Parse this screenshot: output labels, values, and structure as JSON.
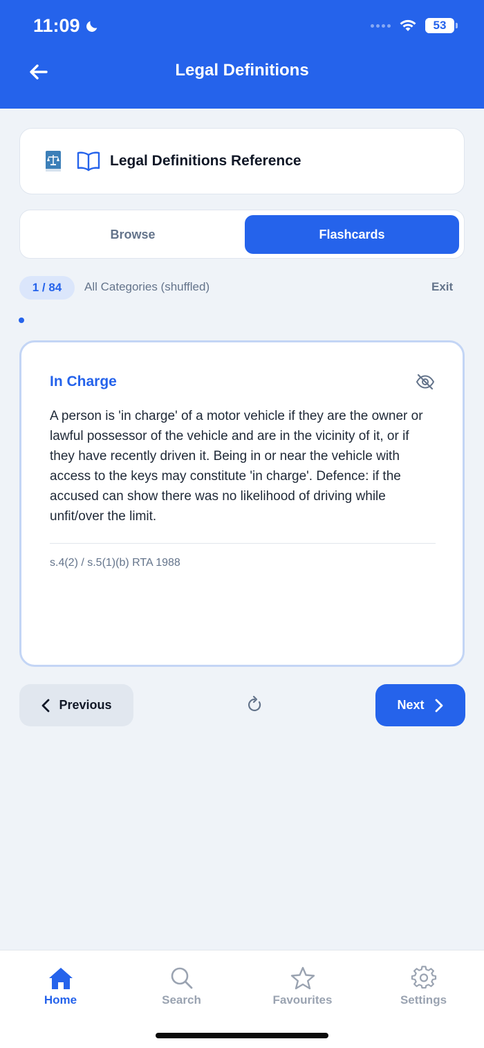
{
  "status_bar": {
    "time": "11:09",
    "battery": "53"
  },
  "header": {
    "title": "Legal Definitions",
    "back_icon": "arrow-left-icon"
  },
  "reference": {
    "title": "Legal Definitions Reference"
  },
  "mode_tabs": [
    {
      "label": "Browse",
      "selected": false
    },
    {
      "label": "Flashcards",
      "selected": true
    }
  ],
  "session": {
    "counter": "1 / 84",
    "category": "All Categories (shuffled)",
    "exit_label": "Exit"
  },
  "card": {
    "term": "In Charge",
    "definition": "A person is 'in charge' of a motor vehicle if they are the owner or lawful possessor of the vehicle and are in the vicinity of it, or if they have recently driven it. Being in or near the vehicle with access to the keys may constitute 'in charge'. Defence: if the accused can show there was no likelihood of driving while unfit/over the limit.",
    "source": "s.4(2) / s.5(1)(b) RTA 1988"
  },
  "navigation": {
    "previous_label": "Previous",
    "next_label": "Next"
  },
  "tabbar": [
    {
      "label": "Home",
      "icon": "home-icon",
      "active": true
    },
    {
      "label": "Search",
      "icon": "search-icon",
      "active": false
    },
    {
      "label": "Favourites",
      "icon": "star-icon",
      "active": false
    },
    {
      "label": "Settings",
      "icon": "gear-icon",
      "active": false
    }
  ],
  "colors": {
    "primary": "#2563eb",
    "background": "#eff3f8",
    "muted": "#64748b"
  }
}
